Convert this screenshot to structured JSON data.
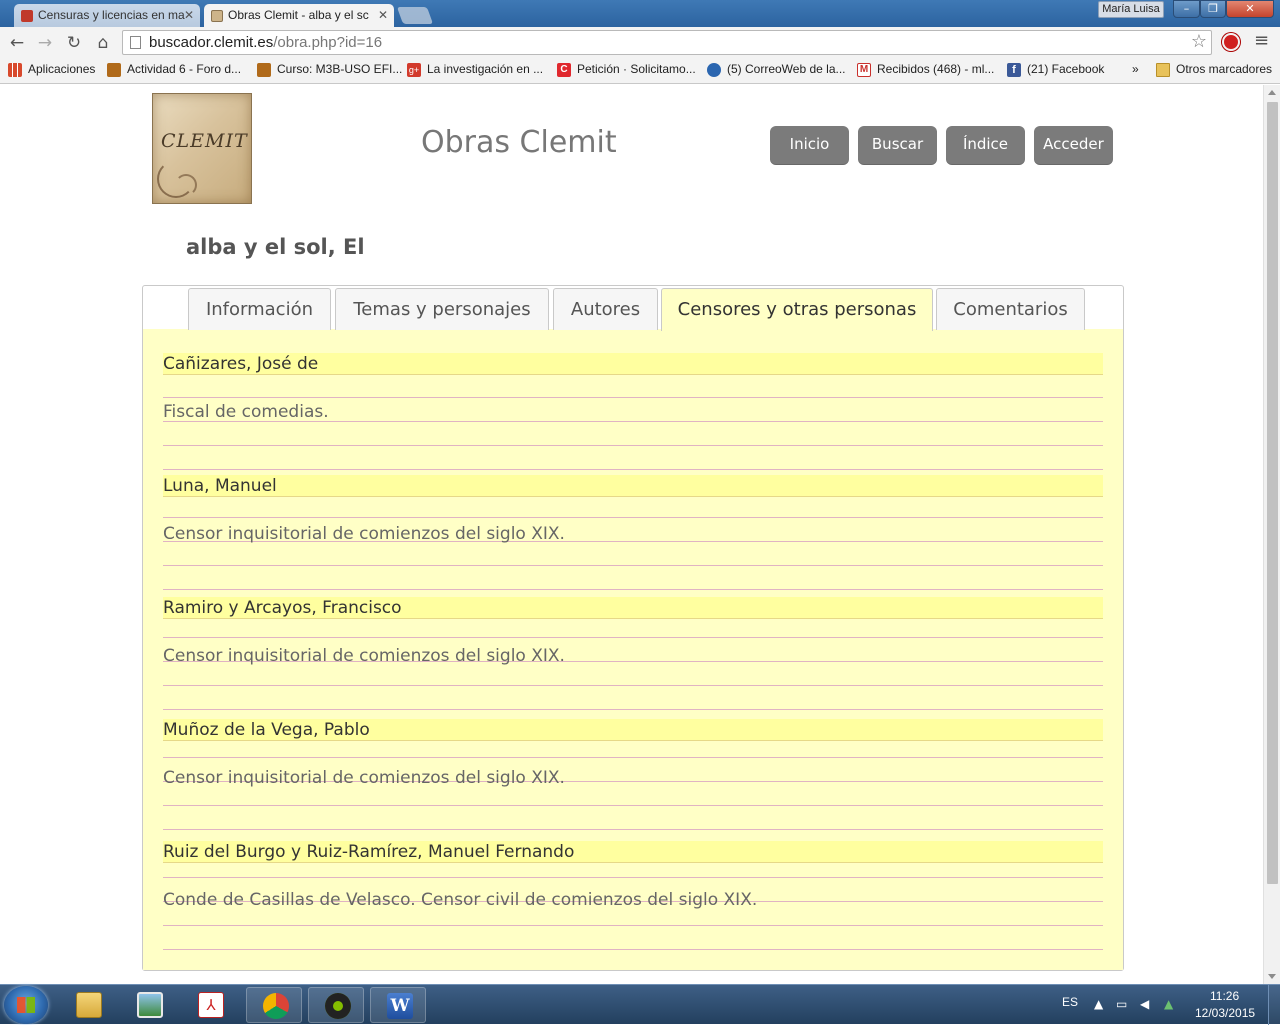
{
  "browser": {
    "tabs": [
      {
        "title": "Censuras y licencias en ma",
        "active": false
      },
      {
        "title": "Obras Clemit - alba y el sc",
        "active": true
      }
    ],
    "user": "María Luisa",
    "url_host": "buscador.clemit.es",
    "url_path": "/obra.php?id=16",
    "bookmarks": [
      {
        "label": "Aplicaciones",
        "icon": "apps-grid-icon",
        "color": "#d8492c"
      },
      {
        "label": "Actividad 6 - Foro d...",
        "icon": "moodle-icon",
        "color": "#b06a1a"
      },
      {
        "label": "Curso: M3B-USO EFI...",
        "icon": "moodle-icon",
        "color": "#b06a1a"
      },
      {
        "label": "La investigación en ...",
        "icon": "google-plus-icon",
        "color": "#d23a2c"
      },
      {
        "label": "Petición · Solicitamo...",
        "icon": "change-org-icon",
        "color": "#e0282e"
      },
      {
        "label": "(5) CorreoWeb de la...",
        "icon": "mail-icon",
        "color": "#2b66b0"
      },
      {
        "label": "Recibidos (468) - ml...",
        "icon": "gmail-icon",
        "color": "#c9302c"
      },
      {
        "label": "(21) Facebook",
        "icon": "facebook-icon",
        "color": "#3b5998"
      }
    ],
    "bookmarks_more": "»",
    "other_bookmarks": "Otros marcadores"
  },
  "site": {
    "logo_text": "CLEMIT",
    "title": "Obras Clemit",
    "nav": [
      "Inicio",
      "Buscar",
      "Índice",
      "Acceder"
    ]
  },
  "work": {
    "title": "alba y el sol, El",
    "tabs": [
      "Información",
      "Temas y personajes",
      "Autores",
      "Censores y otras personas",
      "Comentarios"
    ],
    "active_tab": "Censores y otras personas",
    "people": [
      {
        "name": "Cañizares, José de",
        "description": "Fiscal de comedias."
      },
      {
        "name": "Luna, Manuel",
        "description": "Censor inquisitorial de comienzos del siglo XIX."
      },
      {
        "name": "Ramiro y Arcayos, Francisco",
        "description": "Censor inquisitorial de comienzos del siglo XIX."
      },
      {
        "name": "Muñoz de la Vega, Pablo",
        "description": "Censor inquisitorial de comienzos del siglo XIX."
      },
      {
        "name": "Ruiz del Burgo y Ruiz-Ramírez, Manuel Fernando",
        "description": "Conde de Casillas de Velasco. Censor civil de comienzos del siglo XIX."
      }
    ]
  },
  "taskbar": {
    "language": "ES",
    "time": "11:26",
    "date": "12/03/2015"
  },
  "colors": {
    "panel_background": "#ffffc6",
    "name_highlight": "#ffff9f",
    "ruled_line": "#e0b3c3",
    "nav_button": "#7b7b7b"
  }
}
